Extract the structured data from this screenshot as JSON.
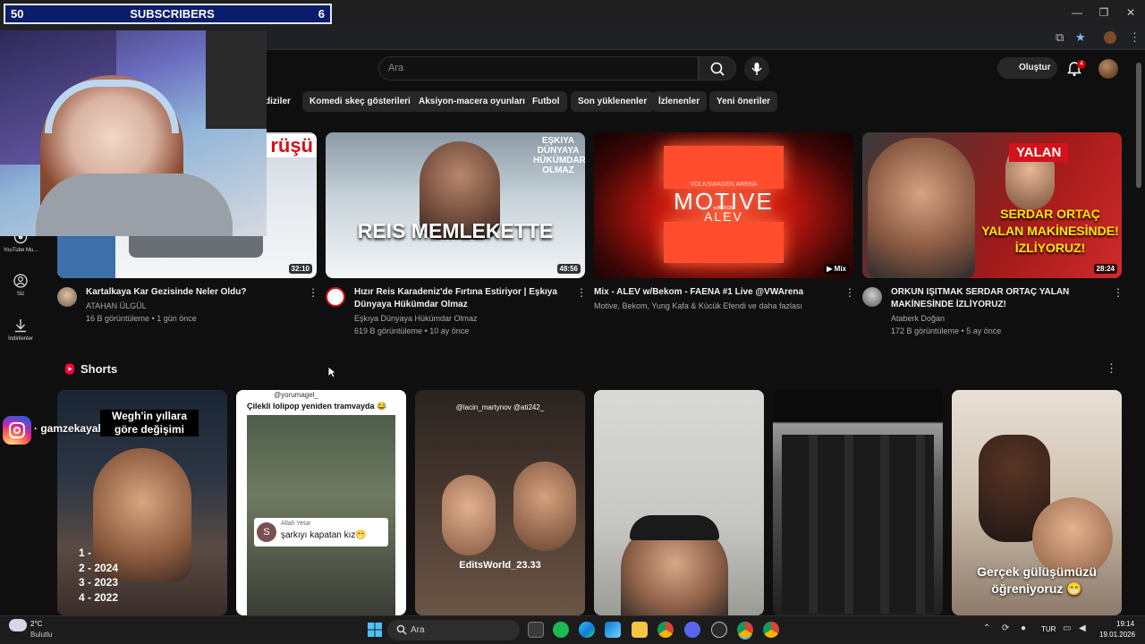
{
  "overlay": {
    "count_left": "50",
    "label": "SUBSCRIBERS",
    "count_right": "6"
  },
  "header": {
    "search_placeholder": "Ara",
    "create_label": "Oluştur",
    "notifications_count": "4"
  },
  "chips": [
    "diziler",
    "Komedi skeç gösterileri",
    "Aksiyon-macera oyunları",
    "Futbol",
    "Son yüklenenler",
    "İzlenenler",
    "Yeni öneriler"
  ],
  "sidebar": {
    "items": [
      {
        "label": "YouTube Mu...",
        "icon": "youtube-music-icon"
      },
      {
        "label": "Siz",
        "icon": "user-icon"
      },
      {
        "label": "İndirilenler",
        "icon": "download-icon"
      }
    ]
  },
  "videos": [
    {
      "thumb_text": "rüşü",
      "duration": "32:10",
      "title": "Kartalkaya Kar Gezisinde Neler Oldu?",
      "channel": "ATAHAN ÜLGÜL",
      "stats": "16 B görüntüleme • 1 gün önce"
    },
    {
      "thumb_text_top": "EŞKIYA DÜNYAYA HÜKÜMDAR OLMAZ",
      "thumb_text_big": "REIS MEMLEKETTE",
      "duration": "48:56",
      "title": "Hızır Reis Karadeniz'de Fırtına Estiriyor | Eşkıya Dünyaya Hükümdar Olmaz",
      "channel": "Eşkıya Dünyaya Hükümdar Olmaz",
      "stats": "619 B görüntüleme • 10 ay önce"
    },
    {
      "thumb_text_small": "VOLKSWAGEN ARENA",
      "thumb_text_big": "MOTIVE",
      "thumb_text_sub": "w/BEKOM",
      "thumb_text_name": "ALEV",
      "duration": "Mix",
      "title": "Mix - ALEV w/Bekom - FAENA #1 Live @VWArena",
      "channel": "Motive, Bekom, Yung Kafa & Kücük Efendi ve daha fazlası",
      "stats": ""
    },
    {
      "thumb_text_tag": "YALAN",
      "thumb_text_big": "SERDAR ORTAÇ YALAN MAKİNESİNDE! İZLİYORUZ!",
      "duration": "28:24",
      "title": "ORKUN IŞITMAK SERDAR ORTAÇ YALAN MAKİNESİNDE İZLİYORUZ!",
      "channel": "Ataberk Doğan",
      "stats": "172 B görüntüleme • 5 ay önce"
    }
  ],
  "shorts": {
    "title": "Shorts",
    "items": [
      {
        "caption": "Wegh'in yıllara göre değişimi",
        "list": [
          "1 -",
          "2 - 2024",
          "3 - 2023",
          "4 - 2022"
        ]
      },
      {
        "handle": "@yorumagel_",
        "caption": "Çilekli lolipop yeniden tramvayda 😂",
        "comment_user": "Allah Yetər",
        "comment": "şarkıyı kapatan kız😁"
      },
      {
        "handle": "@lacin_martynov @ati242_",
        "caption": "EditsWorld_23.33"
      },
      {
        "caption": ""
      },
      {
        "caption": ""
      },
      {
        "caption": "Gerçek gülüşümüzü öğreniyoruz 😁"
      }
    ]
  },
  "instagram": {
    "handle": "gamzekayal"
  },
  "taskbar": {
    "weather_temp": "2°C",
    "weather_desc": "Bulutlu",
    "search_label": "Ara",
    "lang": "TUR",
    "time": "19:14",
    "date": "19.01.2026"
  }
}
